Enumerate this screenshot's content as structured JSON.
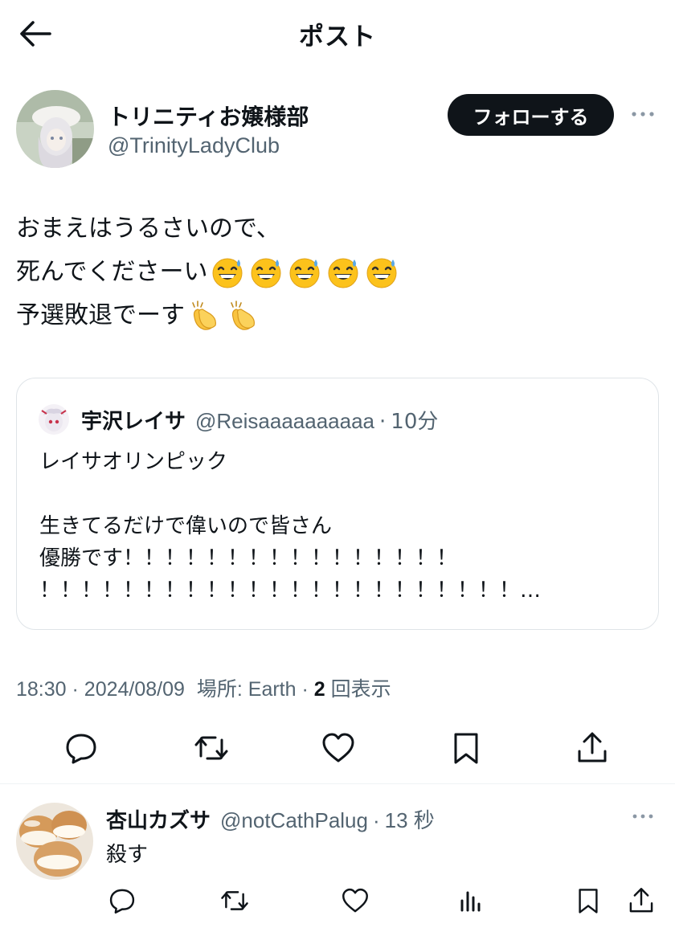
{
  "header": {
    "title": "ポスト"
  },
  "post": {
    "author_name": "トリニティお嬢様部",
    "author_handle": "@TrinityLadyClub",
    "follow_label": "フォローする",
    "lines": [
      {
        "text": "おまえはうるさいので、",
        "emoji": []
      },
      {
        "text": "死んでくださーい",
        "emoji": [
          "grinning-sweat",
          "grinning-sweat",
          "grinning-sweat",
          "grinning-sweat",
          "grinning-sweat"
        ]
      },
      {
        "text": "予選敗退でーす",
        "emoji": [
          "clapping-hands",
          "clapping-hands"
        ]
      }
    ],
    "quote": {
      "author_name": "宇沢レイサ",
      "author_handle": "@Reisaaaaaaaaaa",
      "time": "10分",
      "body": "レイサオリンピック\n\n生きてるだけで偉いので皆さん\n優勝です！！！！！！！！！！！！！！！！\n！！！！！！！！！！！！！！！！！！！！！！！…"
    },
    "time": "18:30",
    "date": "2024/08/09",
    "location_label": "場所: Earth",
    "views_count": "2",
    "views_label": "回表示"
  },
  "reply": {
    "author_name": "杏山カズサ",
    "author_handle": "@notCathPalug",
    "time": "13 秒",
    "text": "殺す"
  },
  "colors": {
    "text": "#0f1419",
    "secondary": "#536471",
    "border": "#dfe4e8",
    "button_bg": "#0f1419"
  }
}
